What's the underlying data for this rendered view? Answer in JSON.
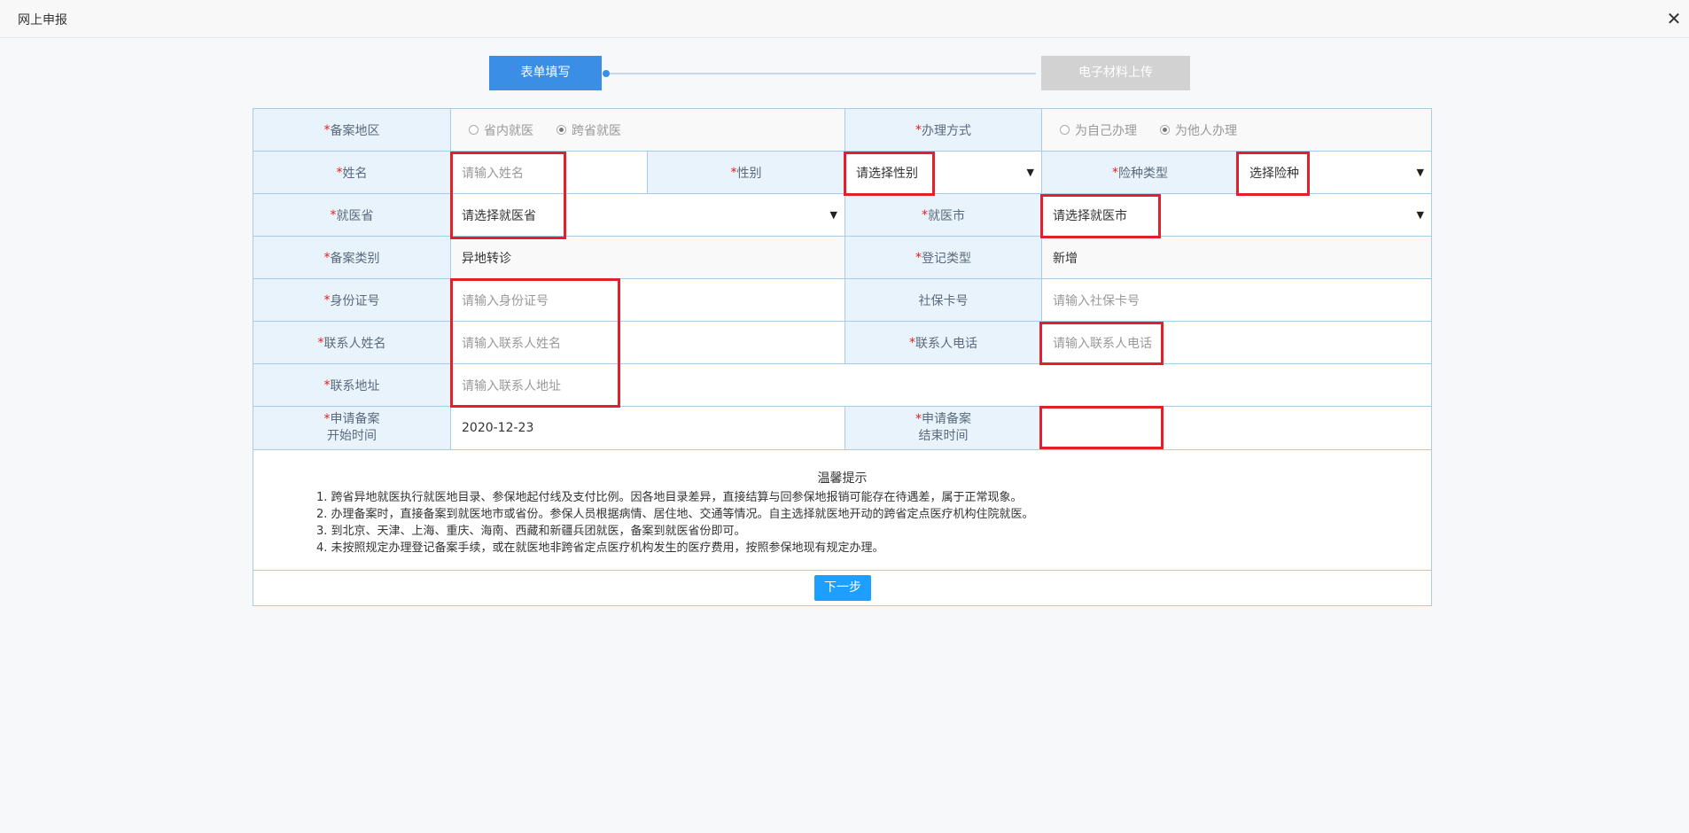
{
  "window": {
    "title": "网上申报"
  },
  "steps": {
    "step1": "表单填写",
    "step2": "电子材料上传"
  },
  "form": {
    "row1": {
      "area_label": "备案地区",
      "area_opt1": "省内就医",
      "area_opt2": "跨省就医",
      "method_label": "办理方式",
      "method_opt1": "为自己办理",
      "method_opt2": "为他人办理"
    },
    "row2": {
      "name_label": "姓名",
      "name_placeholder": "请输入姓名",
      "gender_label": "性别",
      "gender_value": "请选择性别",
      "insurance_label": "险种类型",
      "insurance_value": "选择险种"
    },
    "row3": {
      "province_label": "就医省",
      "province_value": "请选择就医省",
      "city_label": "就医市",
      "city_value": "请选择就医市"
    },
    "row4": {
      "category_label": "备案类别",
      "category_value": "异地转诊",
      "reg_type_label": "登记类型",
      "reg_type_value": "新增"
    },
    "row5": {
      "id_label": "身份证号",
      "id_placeholder": "请输入身份证号",
      "card_label": "社保卡号",
      "card_placeholder": "请输入社保卡号"
    },
    "row6": {
      "contact_name_label": "联系人姓名",
      "contact_name_placeholder": "请输入联系人姓名",
      "contact_phone_label": "联系人电话",
      "contact_phone_placeholder": "请输入联系人电话"
    },
    "row7": {
      "address_label": "联系地址",
      "address_placeholder": "请输入联系人地址"
    },
    "row8": {
      "start_label_1": "申请备案",
      "start_label_2": "开始时间",
      "start_value": "2020-12-23",
      "end_label_1": "申请备案",
      "end_label_2": "结束时间",
      "end_value": ""
    },
    "required_mark": "*"
  },
  "tips": {
    "title": "温馨提示",
    "lines": [
      "1. 跨省异地就医执行就医地目录、参保地起付线及支付比例。因各地目录差异，直接结算与回参保地报销可能存在待遇差，属于正常现象。",
      "2. 办理备案时，直接备案到就医地市或省份。参保人员根据病情、居住地、交通等情况。自主选择就医地开动的跨省定点医疗机构住院就医。",
      "3. 到北京、天津、上海、重庆、海南、西藏和新疆兵团就医，备案到就医省份即可。",
      "4. 未按照规定办理登记备案手续，或在就医地非跨省定点医疗机构发生的医疗费用，按照参保地现有规定办理。"
    ]
  },
  "buttons": {
    "next": "下一步"
  },
  "colors": {
    "primary": "#3a8ee6",
    "accent_red": "#e41f2a",
    "label_bg": "#e9f3fb",
    "border": "#a8cbe6"
  }
}
